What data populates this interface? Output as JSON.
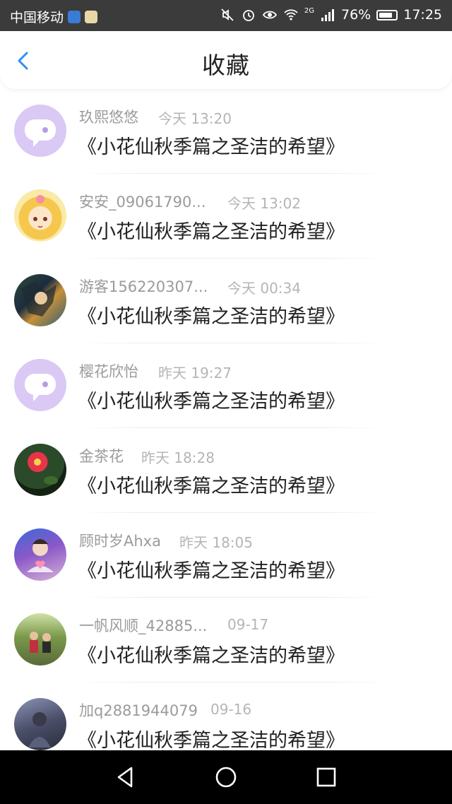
{
  "status_bar": {
    "carrier": "中国移动",
    "network": "2G",
    "battery": "76%",
    "time": "17:25"
  },
  "header": {
    "title": "收藏",
    "back_icon": "chevron-left-icon"
  },
  "favorites": [
    {
      "user": "玖熙悠悠",
      "time": "今天 13:20",
      "title": "《小花仙秋季篇之圣洁的希望》",
      "avatar": "default"
    },
    {
      "user": "安安_09061790...",
      "time": "今天 13:02",
      "title": "《小花仙秋季篇之圣洁的希望》",
      "avatar": "anime-girl"
    },
    {
      "user": "游客156220307...",
      "time": "今天 00:34",
      "title": "《小花仙秋季篇之圣洁的希望》",
      "avatar": "anime-hero"
    },
    {
      "user": "樱花欣怡",
      "time": "昨天 19:27",
      "title": "《小花仙秋季篇之圣洁的希望》",
      "avatar": "default"
    },
    {
      "user": "金茶花",
      "time": "昨天 18:28",
      "title": "《小花仙秋季篇之圣洁的希望》",
      "avatar": "camellia-flower"
    },
    {
      "user": "顾时岁Ahxa",
      "time": "昨天 18:05",
      "title": "《小花仙秋季篇之圣洁的希望》",
      "avatar": "person-heart"
    },
    {
      "user": "一帆风顺_42885...",
      "time": "09-17",
      "title": "《小花仙秋季篇之圣洁的希望》",
      "avatar": "group-photo"
    },
    {
      "user": "加q2881944079",
      "time": "09-16",
      "title": "《小花仙秋季篇之圣洁的希望》",
      "avatar": "dark-portrait"
    }
  ],
  "colors": {
    "accent": "#2f8ff0",
    "username": "#9b9b9b",
    "time": "#b5b5b5",
    "title_text": "#222222",
    "default_avatar": "#d9c9f4"
  }
}
